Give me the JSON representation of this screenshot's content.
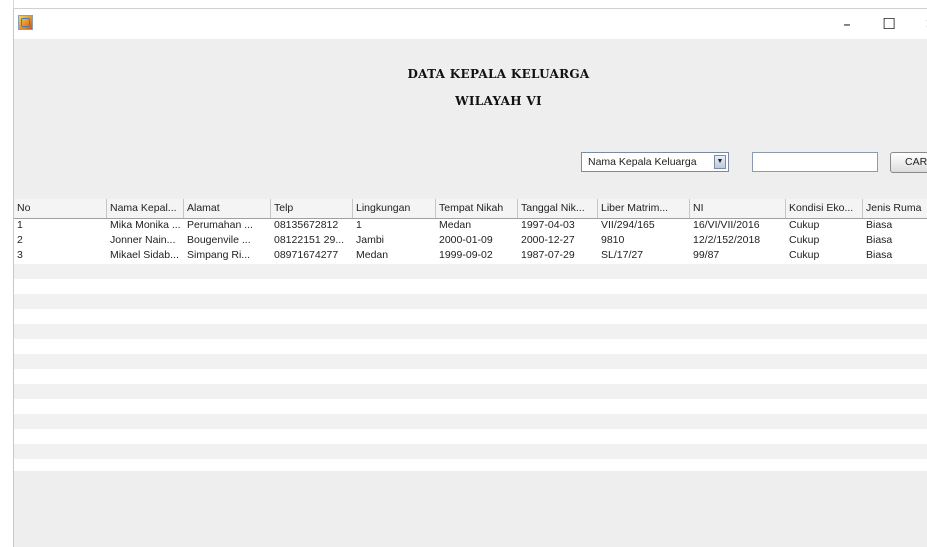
{
  "window": {
    "title": "",
    "controls": {
      "minimize": "–",
      "maximize": "☐",
      "close": "✕"
    }
  },
  "header": {
    "title_line1": "DATA KEPALA KELUARGA",
    "title_line2": "WILAYAH VI"
  },
  "search": {
    "field_select": "Nama Kepala Keluarga",
    "input_value": "",
    "button_label": "CARI"
  },
  "table": {
    "columns": [
      "No",
      "Nama Kepal...",
      "Alamat",
      "Telp",
      "Lingkungan",
      "Tempat Nikah",
      "Tanggal Nik...",
      "Liber Matrim...",
      "NI",
      "Kondisi Eko...",
      "Jenis Ruma"
    ],
    "rows": [
      [
        "1",
        "Mika Monika ...",
        "Perumahan ...",
        "08135672812",
        "1",
        "Medan",
        "1997-04-03",
        "VII/294/165",
        "16/VI/VII/2016",
        "Cukup",
        "Biasa"
      ],
      [
        "2",
        "Jonner Nain...",
        "Bougenvile ...",
        "08122151 29...",
        "Jambi",
        "2000-01-09",
        "2000-12-27",
        "9810",
        "12/2/152/2018",
        "Cukup",
        "Biasa"
      ],
      [
        "3",
        "Mikael Sidab...",
        "Simpang Ri...",
        "08971674277",
        "Medan",
        "1999-09-02",
        "1987-07-29",
        "SL/17/27",
        "99/87",
        "Cukup",
        "Biasa"
      ]
    ],
    "empty_row_count": 14
  }
}
